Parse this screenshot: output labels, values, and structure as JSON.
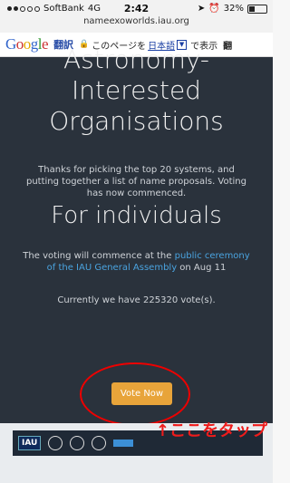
{
  "status_bar": {
    "carrier": "SoftBank",
    "network": "4G",
    "time": "2:42",
    "url": "nameexoworlds.iau.org",
    "battery": "32%"
  },
  "translate_bar": {
    "logo": "Google",
    "translate_label": "翻訳",
    "prompt_text": "このページを",
    "language": "日本語",
    "show_label": "で表示",
    "truncated_button": "翻"
  },
  "page": {
    "heading_line1": "Astronomy-",
    "heading_line2": "Interested",
    "heading_line3": "Organisations",
    "intro_text": "Thanks for picking the top 20 systems, and putting together a list of name proposals. Voting has now commenced.",
    "individuals_heading": "For individuals",
    "voting_text_before": "The voting will commence at the ",
    "voting_link": "public ceremony of the IAU General Assembly",
    "voting_text_after": " on Aug 11",
    "votes_text": "Currently we have 225320 vote(s).",
    "vote_button": "Vote Now"
  },
  "annotation": {
    "text": "↑ここをタップ",
    "color": "#ee1c1c"
  },
  "footer": {
    "logo_label": "IAU"
  },
  "colors": {
    "page_bg": "#2a323c",
    "button": "#e8a43a",
    "link": "#4aa3df"
  }
}
